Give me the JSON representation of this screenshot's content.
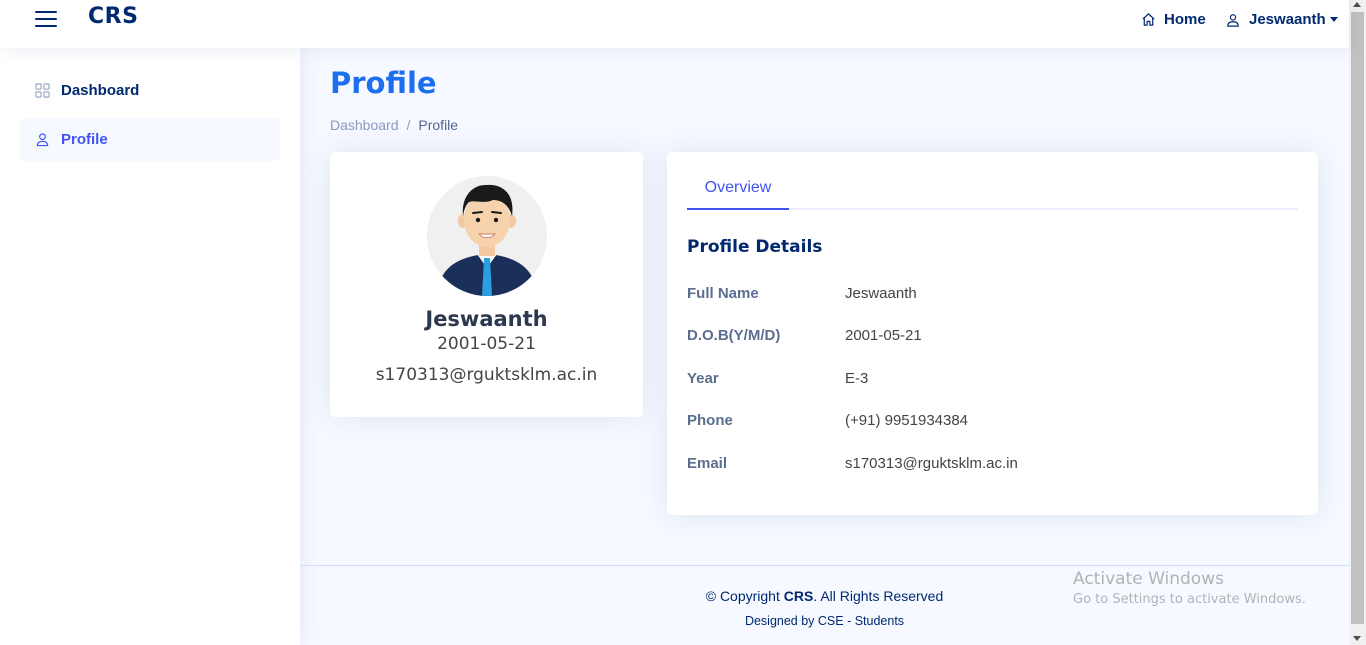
{
  "header": {
    "logo": "CRS",
    "home_label": "Home",
    "user_name": "Jeswaanth"
  },
  "sidebar": {
    "items": [
      {
        "label": "Dashboard",
        "icon": "grid-icon",
        "active": false
      },
      {
        "label": "Profile",
        "icon": "person-icon",
        "active": true
      }
    ]
  },
  "main": {
    "page_title": "Profile",
    "breadcrumb": [
      "Dashboard",
      "Profile"
    ]
  },
  "profile_card": {
    "name": "Jeswaanth",
    "dob": "2001-05-21",
    "email": "s170313@rguktsklm.ac.in",
    "avatar": "avatar-illustration"
  },
  "details_card": {
    "tab_overview": "Overview",
    "section_title": "Profile Details",
    "fields": [
      {
        "label": "Full Name",
        "value": "Jeswaanth"
      },
      {
        "label": "D.O.B(Y/M/D)",
        "value": "2001-05-21"
      },
      {
        "label": "Year",
        "value": "E-3"
      },
      {
        "label": "Phone",
        "value": "(+91) 9951934384"
      },
      {
        "label": "Email",
        "value": "s170313@rguktsklm.ac.in"
      }
    ]
  },
  "footer": {
    "copyright_prefix": "© Copyright ",
    "copyright_brand": "CRS",
    "copyright_suffix": ". All Rights Reserved",
    "credits": "Designed by CSE - Students"
  },
  "watermark": {
    "title": "Activate Windows",
    "subtitle": "Go to Settings to activate Windows."
  },
  "colors": {
    "accent": "#4154f1",
    "title": "#1e6ff0",
    "navy": "#012970",
    "bg": "#f6f9ff"
  }
}
